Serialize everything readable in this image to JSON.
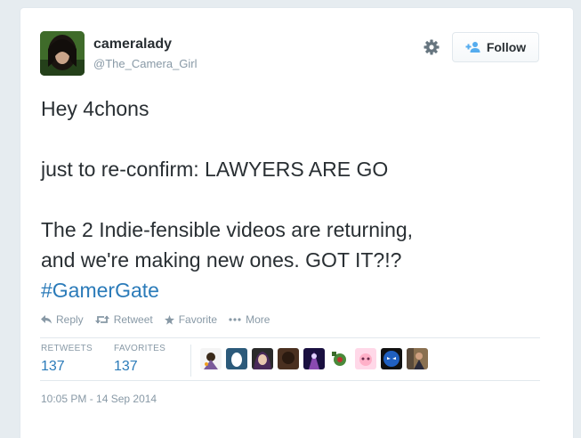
{
  "user": {
    "name": "cameralady",
    "handle": "@The_Camera_Girl"
  },
  "follow_label": "Follow",
  "tweet": {
    "line1": "Hey 4chons",
    "line2": "just to re-confirm: LAWYERS ARE GO",
    "line3": "The 2 Indie-fensible videos are returning,",
    "line4": "and we're making new ones. GOT IT?!?",
    "hashtag": "#GamerGate"
  },
  "actions": {
    "reply": "Reply",
    "retweet": "Retweet",
    "favorite": "Favorite",
    "more": "More"
  },
  "stats": {
    "retweets_label": "RETWEETS",
    "retweets_count": "137",
    "favorites_label": "FAVORITES",
    "favorites_count": "137"
  },
  "favoriters_count_shown": 9,
  "timestamp": "10:05 PM - 14 Sep 2014",
  "colors": {
    "link": "#2b7bb9",
    "text": "#292f33",
    "muted": "#8899a6",
    "border": "#e1e8ed"
  }
}
